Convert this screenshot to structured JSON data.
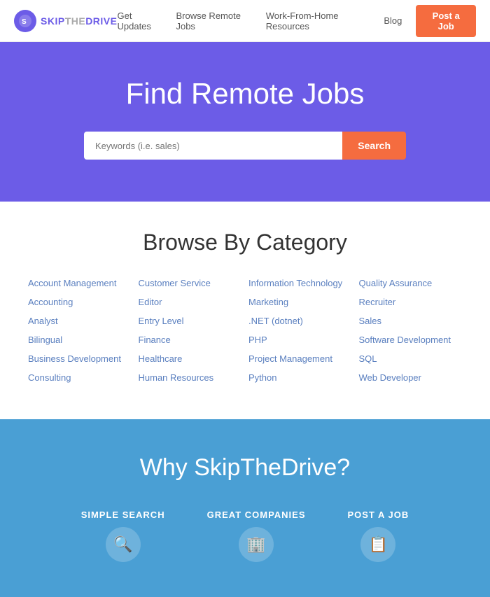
{
  "header": {
    "logo_text_skip": "SKIP",
    "logo_text_the": "THE",
    "logo_text_drive": "DRIVE",
    "logo_full": "SKIPTHEDRIVE",
    "nav_items": [
      {
        "label": "Get Updates",
        "href": "#"
      },
      {
        "label": "Browse Remote Jobs",
        "href": "#"
      },
      {
        "label": "Work-From-Home Resources",
        "href": "#"
      },
      {
        "label": "Blog",
        "href": "#"
      }
    ],
    "post_job_label": "Post a Job"
  },
  "hero": {
    "title": "Find Remote Jobs",
    "search_placeholder": "Keywords (i.e. sales)",
    "search_button_label": "Search"
  },
  "browse": {
    "heading": "Browse By Category",
    "categories": [
      [
        "Account Management",
        "Customer Service",
        "Information Technology",
        "Quality Assurance"
      ],
      [
        "Accounting",
        "Editor",
        "Marketing",
        "Recruiter"
      ],
      [
        "Analyst",
        "Entry Level",
        ".NET (dotnet)",
        "Sales"
      ],
      [
        "Bilingual",
        "Finance",
        "PHP",
        "Software Development"
      ],
      [
        "Business Development",
        "Healthcare",
        "Project Management",
        "SQL"
      ],
      [
        "Consulting",
        "Human Resources",
        "Python",
        "Web Developer"
      ]
    ]
  },
  "why": {
    "heading": "Why SkipTheDrive?",
    "items": [
      {
        "title": "SIMPLE SEARCH",
        "icon": "🔍"
      },
      {
        "title": "GREAT COMPANIES",
        "icon": "🏢"
      },
      {
        "title": "POST A JOB",
        "icon": "📋"
      }
    ]
  }
}
